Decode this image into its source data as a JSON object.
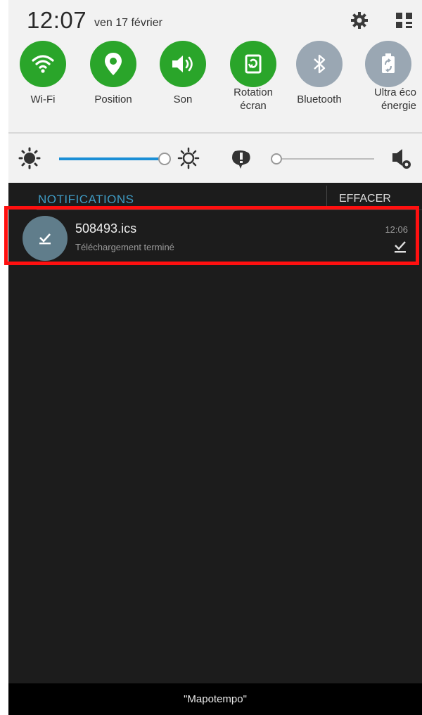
{
  "status": {
    "time": "12:07",
    "date": "ven 17 février"
  },
  "icons": {
    "settings": "gear-icon",
    "menu": "grid-toggle-icon"
  },
  "quick_settings": [
    {
      "label": "Wi-Fi",
      "icon": "wifi-icon",
      "active": true
    },
    {
      "label": "Position",
      "icon": "location-icon",
      "active": true
    },
    {
      "label": "Son",
      "icon": "volume-icon",
      "active": true
    },
    {
      "label": "Rotation écran",
      "icon": "rotation-icon",
      "active": true
    },
    {
      "label": "Bluetooth",
      "icon": "bluetooth-icon",
      "active": false
    },
    {
      "label": "Ultra éco énergie",
      "icon": "power-saving-icon",
      "active": false
    }
  ],
  "colors": {
    "active": "#2aa52a",
    "inactive": "#9aa7b3",
    "accent": "#3f9bc4",
    "highlight": "#ff1010"
  },
  "notifications": {
    "header": "NOTIFICATIONS",
    "clear_label": "EFFACER",
    "items": [
      {
        "title": "508493.ics",
        "subtitle": "Téléchargement terminé",
        "time": "12:06",
        "icon": "download-done-icon"
      }
    ]
  },
  "toast": "\"Mapotempo\""
}
